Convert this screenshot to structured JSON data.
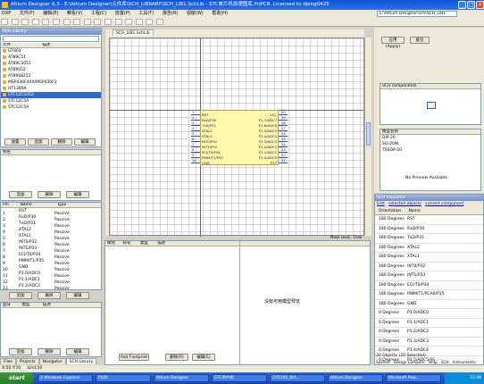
{
  "window": {
    "title": "Altium Designer 6.3 - E:\\Altium Designer\\元件库\\SCH_LIBRARY\\SCH_LIB1.SchLib - STC单片机原理图库.PrjPCB. Licensed to djeng0425",
    "path": "E:\\Altium Designer\\sch\\SCH_LIB1"
  },
  "menu": [
    "DXP",
    "文件(F)",
    "编辑(E)",
    "察看(V)",
    "工程(C)",
    "放置(P)",
    "工具(T)",
    "报告(R)",
    "视窗(W)",
    "帮助(H)"
  ],
  "left": {
    "header": "SCH Library",
    "columns": [
      "元件",
      "描述"
    ],
    "components": [
      {
        "name": "GT801",
        "selected": false
      },
      {
        "name": "AT89C51",
        "selected": false
      },
      {
        "name": "AT89C2051",
        "selected": false
      },
      {
        "name": "AT89S52",
        "selected": false
      },
      {
        "name": "AT89S8252",
        "selected": false
      },
      {
        "name": "MSP430F4XX/MSP430F2",
        "selected": false
      },
      {
        "name": "HT1380A",
        "selected": false
      },
      {
        "name": "STC12C2052",
        "selected": true
      },
      {
        "name": "STC12C5A",
        "selected": false
      },
      {
        "name": "STC12C5A",
        "selected": false
      }
    ],
    "comp_buttons": [
      "放置",
      "追加",
      "删除",
      "编辑"
    ],
    "alias_header": "别名",
    "alias_buttons": [
      "追加",
      "删除",
      "编辑"
    ],
    "pin_columns": [
      "Pin",
      "Name",
      "Type"
    ],
    "pins": [
      {
        "pin": "1",
        "name": "RST",
        "type": "Passive"
      },
      {
        "pin": "2",
        "name": "RxD/P30",
        "type": "Passive"
      },
      {
        "pin": "3",
        "name": "TxD/P31",
        "type": "Passive"
      },
      {
        "pin": "4",
        "name": "XTAL2",
        "type": "Passive"
      },
      {
        "pin": "5",
        "name": "XTAL1",
        "type": "Passive"
      },
      {
        "pin": "6",
        "name": "INT0/P32",
        "type": "Passive"
      },
      {
        "pin": "7",
        "name": "INT1/P33",
        "type": "Passive"
      },
      {
        "pin": "8",
        "name": "ECI/T0/P34",
        "type": "Passive"
      },
      {
        "pin": "9",
        "name": "PWM/T1/P35",
        "type": "Passive"
      },
      {
        "pin": "10",
        "name": "GND",
        "type": "Passive"
      },
      {
        "pin": "11",
        "name": "P1.0/ADC0",
        "type": "Passive"
      },
      {
        "pin": "12",
        "name": "P1.1/ADC1",
        "type": "Passive"
      },
      {
        "pin": "13",
        "name": "P1.2/ADC2",
        "type": "Passive"
      }
    ],
    "pin_buttons": [
      "追加",
      "删除",
      "编辑"
    ],
    "model_columns": [
      "型号",
      "类型",
      "描述"
    ],
    "model_buttons": [
      "追加",
      "删除",
      "编辑"
    ],
    "bottom_tabs": [
      "Files",
      "Projects",
      "Navigator",
      "SCH Library"
    ]
  },
  "doc_tab": "SCH_LIB1.SchLib",
  "chip": {
    "left_pins": [
      "RST",
      "RxD/P30",
      "TxD/P31",
      "XTAL2",
      "XTAL1",
      "INT0/P32",
      "INT1/P33",
      "ECI/T0/P34",
      "PWM/T1/P35",
      "GND"
    ],
    "right_pins": [
      "VCC",
      "P1.7/ADC7",
      "P1.6/ADC6",
      "P1.5/ADC5",
      "P1.4/ADC4",
      "P1.3/ADC3",
      "P1.2/ADC2",
      "P1.1/ADC1",
      "P1.0/ADC0",
      "P37"
    ],
    "left_nums": [
      "1",
      "2",
      "3",
      "4",
      "5",
      "6",
      "7",
      "8",
      "9",
      "10"
    ],
    "right_nums": [
      "20",
      "19",
      "18",
      "17",
      "16",
      "15",
      "14",
      "13",
      "12",
      "11"
    ]
  },
  "bottom_panel": {
    "columns": [
      "模式",
      "标号",
      "类型",
      "描述"
    ],
    "buttons": [
      "Add Footprint",
      "删除(R)",
      "编辑(E)"
    ],
    "no_model": "没有可用模型预览",
    "mask_label": "Mask Level",
    "clear_label": "Clear"
  },
  "right": {
    "buttons": [
      "应用(Apply)",
      "复位"
    ],
    "header": "SCH components",
    "model_header": "模型名称",
    "models": [
      "DIP-20",
      "SO-20W",
      "TSSOP-20"
    ],
    "no_preview": "No Preview Available",
    "inspector_header": "SCH Inspector",
    "inspector_tabs": [
      "Edit",
      "selected objects",
      "current component"
    ],
    "grid_columns": [
      "Orientation",
      "Name"
    ],
    "grid_rows": [
      {
        "o": "180 Degrees",
        "n": "RST"
      },
      {
        "o": "180 Degrees",
        "n": "RxD/P30"
      },
      {
        "o": "180 Degrees",
        "n": "TxD/P31"
      },
      {
        "o": "180 Degrees",
        "n": "XTAL2"
      },
      {
        "o": "180 Degrees",
        "n": "XTAL1"
      },
      {
        "o": "180 Degrees",
        "n": "INT0/P32"
      },
      {
        "o": "180 Degrees",
        "n": "INT1/P33"
      },
      {
        "o": "180 Degrees",
        "n": "ECI/T0/P34"
      },
      {
        "o": "180 Degrees",
        "n": "PWM/T1/PCA0/P35"
      },
      {
        "o": "180 Degrees",
        "n": "GND"
      },
      {
        "o": "0 Degrees",
        "n": "P1.0/ADC0"
      },
      {
        "o": "0 Degrees",
        "n": "P1.1/ADC1"
      },
      {
        "o": "0 Degrees",
        "n": "P1.2/ADC2"
      },
      {
        "o": "0 Degrees",
        "n": "P1.3/ADC3"
      },
      {
        "o": "0 Degrees",
        "n": "P1.4/ADC4"
      },
      {
        "o": "0 Degrees",
        "n": "P1.5/ADC5/SS"
      },
      {
        "o": "0 Degrees",
        "n": "P1.6/ADC6/MISO"
      },
      {
        "o": "0 Degrees",
        "n": "P1.7/ADC7/SCLK"
      }
    ],
    "status": "20 Objects (20 Selected)",
    "bottom_tabs": [
      "System",
      "Design Compiler",
      "Help",
      "SCH",
      "Instruments"
    ]
  },
  "statusbar": {
    "coords": "X:50 Y:70",
    "grid": "Grid:10"
  },
  "taskbar": {
    "start": "start",
    "tasks": [
      "2 Windows Explorer",
      "PS01",
      "Altium Designer",
      "STC单片机",
      "CP2102_MA...",
      "Altium Designer",
      "Microsoft Pow..."
    ],
    "clock": "12:48"
  }
}
